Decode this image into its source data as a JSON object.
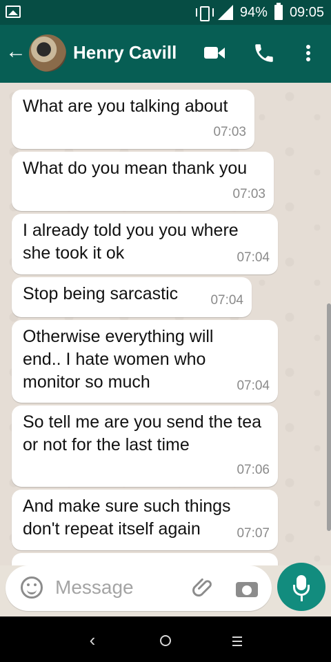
{
  "status_bar": {
    "battery": "94%",
    "time": "09:05"
  },
  "app_bar": {
    "contact_name": "Henry Cavill"
  },
  "messages": [
    {
      "text": "What are you talking about",
      "time": "07:03"
    },
    {
      "text": "What do you mean thank you",
      "time": "07:03"
    },
    {
      "text": "I already told you you where she took it ok",
      "time": "07:04"
    },
    {
      "text": "Stop being sarcastic",
      "time": "07:04"
    },
    {
      "text": "Otherwise everything will end.. I hate women who monitor so much",
      "time": "07:04"
    },
    {
      "text": "So tell me are you send the tea or not for the last time",
      "time": "07:06"
    },
    {
      "text": "And make sure such things don't repeat itself again",
      "time": "07:07"
    }
  ],
  "composer": {
    "placeholder": "Message"
  },
  "colors": {
    "header": "#075e54",
    "status_bar": "#064d44",
    "fab": "#128c7e",
    "chat_background": "#e5ddd5",
    "bubble": "#ffffff"
  },
  "icons": [
    "image-icon",
    "vibrate-icon",
    "signal-icon",
    "battery-icon",
    "back-arrow-icon",
    "video-call-icon",
    "phone-icon",
    "more-vert-icon",
    "emoji-icon",
    "attach-icon",
    "camera-icon",
    "mic-icon"
  ]
}
